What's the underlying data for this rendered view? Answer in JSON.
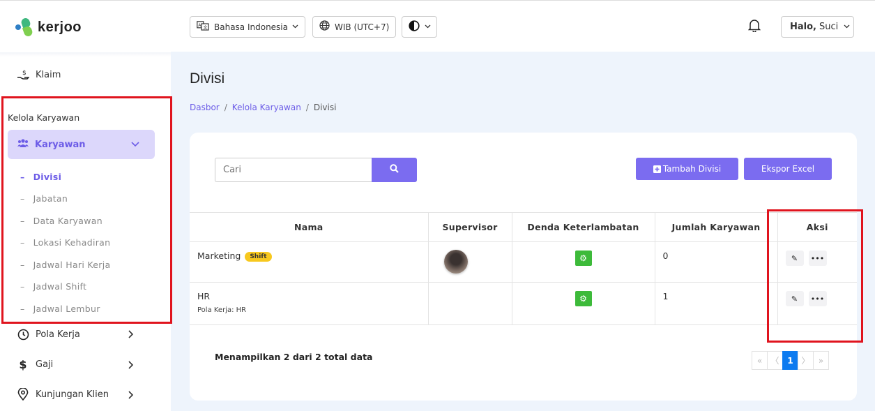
{
  "brand": {
    "name": "kerjoo"
  },
  "sidebar": {
    "klaim_label": "Klaim",
    "section_title": "Kelola Karyawan",
    "karyawan_label": "Karyawan",
    "sub_items": [
      "Divisi",
      "Jabatan",
      "Data Karyawan",
      "Lokasi Kehadiran",
      "Jadwal Hari Kerja",
      "Jadwal Shift",
      "Jadwal Lembur"
    ],
    "pola_kerja_label": "Pola Kerja",
    "gaji_label": "Gaji",
    "kunjungan_label": "Kunjungan Klien"
  },
  "topbar": {
    "language": "Bahasa Indonesia",
    "timezone": "WIB (UTC+7)",
    "greeting": "Halo,",
    "user_name": "Suci"
  },
  "page": {
    "title": "Divisi",
    "breadcrumb": [
      "Dasbor",
      "Kelola Karyawan",
      "Divisi"
    ]
  },
  "toolbar": {
    "search_placeholder": "Cari",
    "add_button": "Tambah Divisi",
    "export_button": "Ekspor Excel"
  },
  "table": {
    "headers": [
      "Nama",
      "Supervisor",
      "Denda Keterlambatan",
      "Jumlah Karyawan",
      "Aksi"
    ],
    "rows": [
      {
        "name": "Marketing",
        "badge": "Shift",
        "sub": "",
        "count": "0",
        "has_supervisor": true
      },
      {
        "name": "HR",
        "badge": "",
        "sub": "Pola Kerja: HR",
        "count": "1",
        "has_supervisor": false
      }
    ]
  },
  "footer": {
    "summary": "Menampilkan 2 dari 2 total data",
    "pagination": {
      "first": "«",
      "prev": "〈",
      "current": "1",
      "next": "〉",
      "last": "»"
    }
  },
  "colors": {
    "accent": "#7b6cf0",
    "highlight": "#e0141e",
    "success": "#3dba3a",
    "badge": "#f7c81e"
  }
}
